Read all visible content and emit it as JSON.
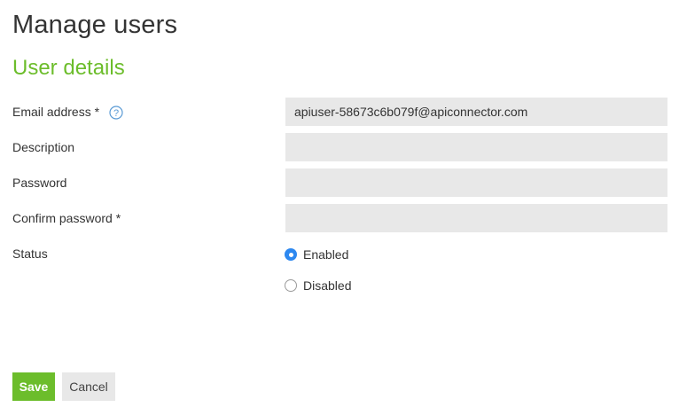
{
  "page": {
    "title": "Manage users",
    "section_title": "User details"
  },
  "form": {
    "email": {
      "label": "Email address *",
      "value": "apiuser-58673c6b079f@apiconnector.com",
      "help_icon": "question-circle-icon"
    },
    "description": {
      "label": "Description",
      "value": ""
    },
    "password": {
      "label": "Password",
      "value": ""
    },
    "confirm_password": {
      "label": "Confirm password *",
      "value": ""
    },
    "status": {
      "label": "Status",
      "options": [
        {
          "label": "Enabled",
          "selected": true
        },
        {
          "label": "Disabled",
          "selected": false
        }
      ]
    }
  },
  "actions": {
    "save_label": "Save",
    "cancel_label": "Cancel"
  },
  "colors": {
    "accent_green": "#6cbd2b",
    "radio_blue": "#2d88f0",
    "field_bg": "#e8e8e8"
  }
}
